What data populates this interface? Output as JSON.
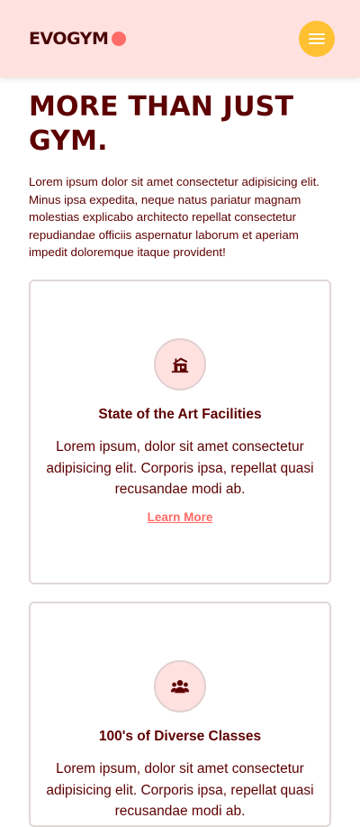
{
  "navbar": {
    "logo_text": "EVOGYM",
    "menu_icon": "hamburger-icon",
    "colors": {
      "background": "#ffe1e0",
      "menu_button": "#ffc132",
      "logo_dot": "#ff6b66"
    }
  },
  "main": {
    "headline": "MORE THAN JUST GYM.",
    "intro": "Lorem ipsum dolor sit amet consectetur adipisicing elit. Minus ipsa expedita, neque natus pariatur magnam molestias explicabo architecto repellat consectetur repudiandae officiis aspernatur laborum et aperiam impedit doloremque itaque provident!"
  },
  "benefits": [
    {
      "icon": "house-icon",
      "title": "State of the Art Facilities",
      "text": "Lorem ipsum, dolor sit amet consectetur adipisicing elit. Corporis ipsa, repellat quasi recusandae modi ab.",
      "link": "Learn More"
    },
    {
      "icon": "user-group-icon",
      "title": "100's of Diverse Classes",
      "text": "Lorem ipsum, dolor sit amet consectetur adipisicing elit. Corporis ipsa, repellat quasi recusandae modi ab."
    }
  ],
  "colors": {
    "primary_text": "#5e0000",
    "accent": "#ff6b66"
  }
}
